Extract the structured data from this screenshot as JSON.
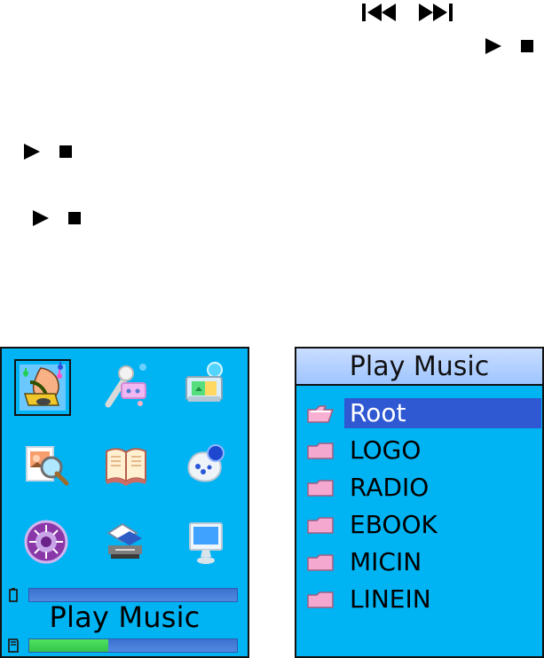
{
  "controls": {
    "row1": {
      "icons": [
        "previous-track-icon",
        "next-track-icon"
      ]
    },
    "row2": {
      "icons": [
        "play-icon",
        "stop-icon"
      ]
    },
    "row3": {
      "icons": [
        "play-icon",
        "stop-icon"
      ]
    },
    "row4": {
      "icons": [
        "play-icon",
        "stop-icon"
      ]
    }
  },
  "main_menu": {
    "title": "Play Music",
    "icons": [
      "music-player-icon",
      "microphone-recorder-icon",
      "picture-viewer-icon",
      "photo-search-icon",
      "ebook-icon",
      "game-controller-icon",
      "settings-disc-icon",
      "file-manager-icon",
      "computer-monitor-icon"
    ],
    "selected_item": "music-player-icon",
    "status": {
      "battery_icon": "battery-icon",
      "storage_icon": "memory-card-icon",
      "playback_progress": 0.38
    }
  },
  "file_browser": {
    "title": "Play Music",
    "items": [
      {
        "label": "Root",
        "icon": "open-folder-icon",
        "selected": true
      },
      {
        "label": "LOGO",
        "icon": "folder-icon",
        "selected": false
      },
      {
        "label": "RADIO",
        "icon": "folder-icon",
        "selected": false
      },
      {
        "label": "EBOOK",
        "icon": "folder-icon",
        "selected": false
      },
      {
        "label": "MICIN",
        "icon": "folder-icon",
        "selected": false
      },
      {
        "label": "LINEIN",
        "icon": "folder-icon",
        "selected": false
      }
    ]
  },
  "colors": {
    "screen_background": "#00b4f3",
    "selection": "#2f59d2",
    "header_top": "#c9ddff",
    "header_bottom": "#9ec5ff",
    "folder_pink": "#f5a7cf",
    "progress_green": "#33c54c",
    "progress_blue": "#4b7fdc"
  }
}
